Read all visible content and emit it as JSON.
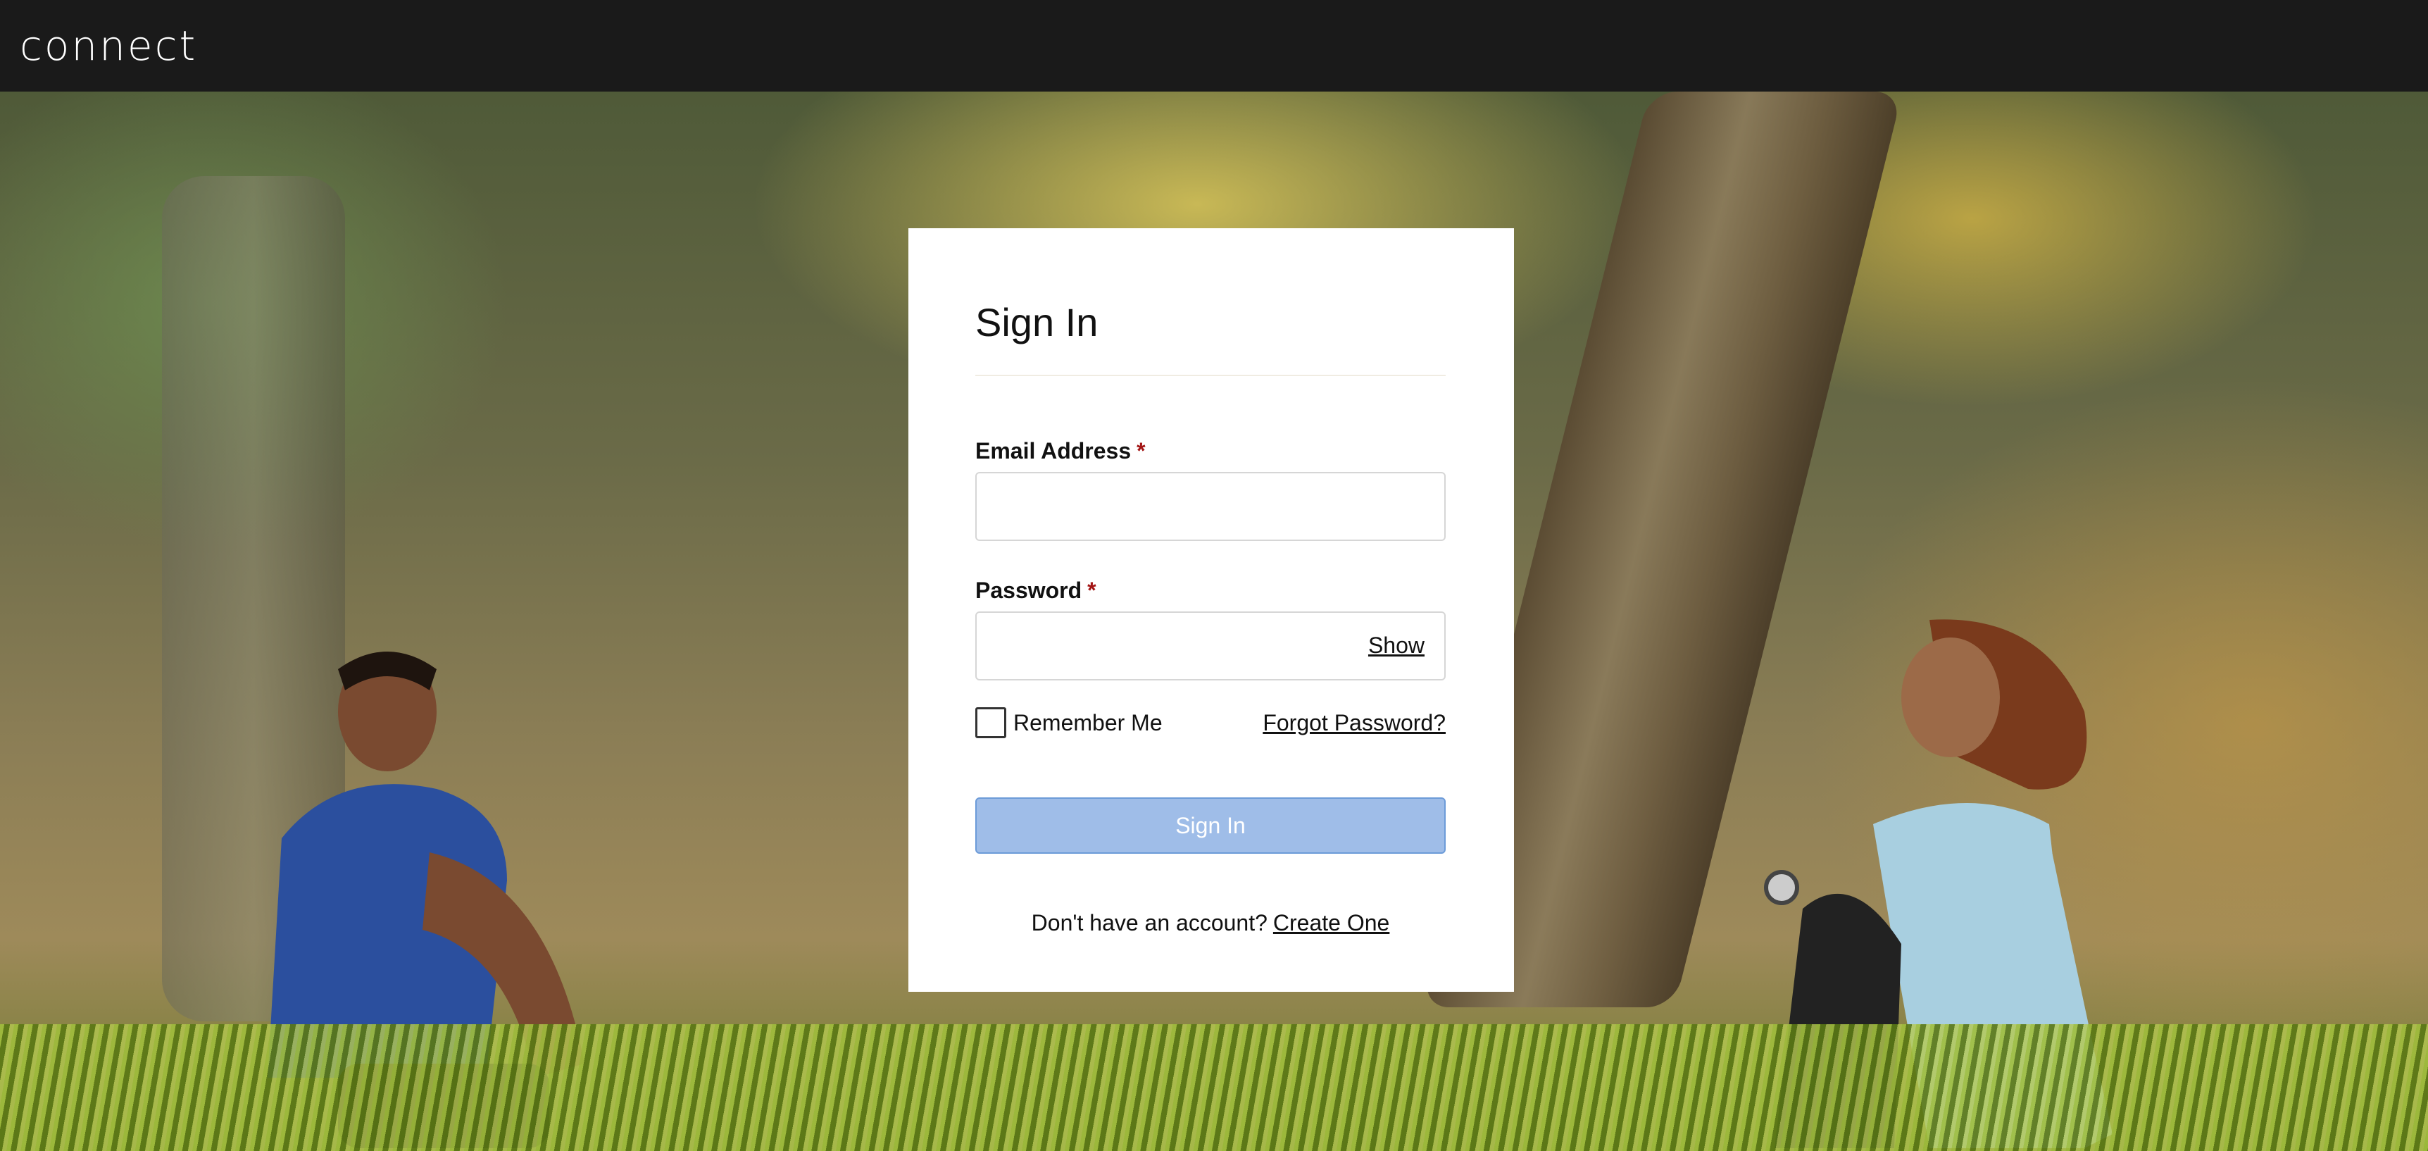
{
  "header": {
    "logo_text": "connect"
  },
  "signin": {
    "title": "Sign In",
    "email": {
      "label": "Email Address",
      "required_marker": "*",
      "value": "",
      "placeholder": ""
    },
    "password": {
      "label": "Password",
      "required_marker": "*",
      "value": "",
      "placeholder": "",
      "show_toggle": "Show"
    },
    "remember_me": {
      "label": "Remember Me",
      "checked": false
    },
    "forgot_password": "Forgot Password?",
    "submit_label": "Sign In",
    "no_account_text": "Don't have an account?",
    "create_link": "Create One"
  },
  "colors": {
    "topbar": "#1a1a1a",
    "required": "#a31515",
    "button_fill": "#9fbde8",
    "button_border": "#6c9bd8"
  },
  "icons": {
    "checkbox": "checkbox-unchecked-icon"
  }
}
